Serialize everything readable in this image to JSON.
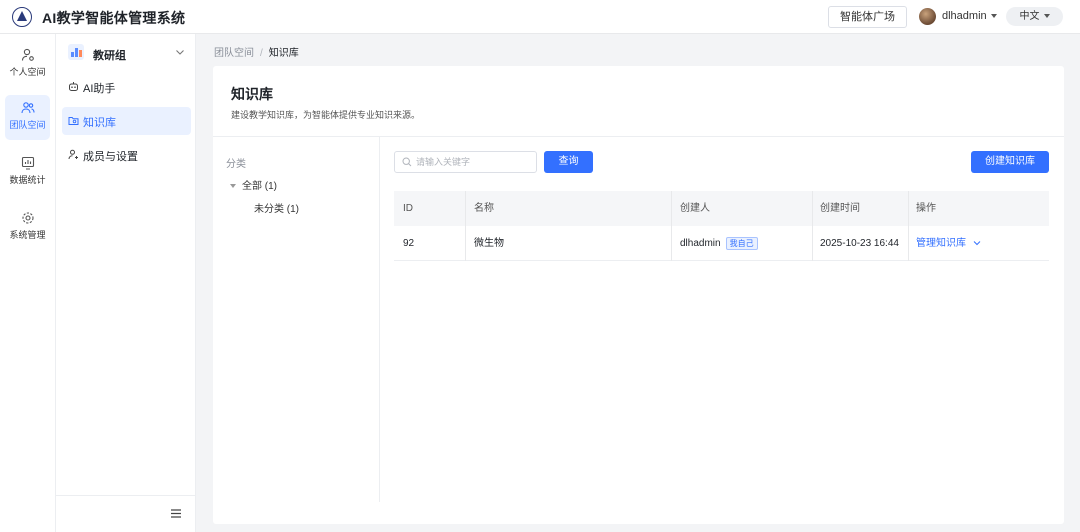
{
  "header": {
    "title": "AI教学智能体管理系统",
    "market_label": "智能体广场",
    "username": "dlhadmin",
    "language": "中文"
  },
  "rail": {
    "items": [
      {
        "label": "个人空间",
        "icon": "user-icon"
      },
      {
        "label": "团队空间",
        "icon": "team-icon"
      },
      {
        "label": "数据统计",
        "icon": "chart-icon"
      },
      {
        "label": "系统管理",
        "icon": "gear-icon"
      }
    ],
    "active_index": 1
  },
  "sidebar": {
    "group_name": "教研组",
    "items": [
      {
        "label": "AI助手",
        "icon": "bot-icon"
      },
      {
        "label": "知识库",
        "icon": "folder-icon"
      },
      {
        "label": "成员与设置",
        "icon": "member-settings-icon"
      }
    ],
    "active_index": 1
  },
  "breadcrumb": [
    "团队空间",
    "知识库"
  ],
  "page": {
    "title": "知识库",
    "description": "建设教学知识库，为智能体提供专业知识来源。"
  },
  "categories": {
    "heading": "分类",
    "all": "全部 (1)",
    "uncategorized": "未分类 (1)"
  },
  "search": {
    "placeholder": "请输入关键字",
    "value": "",
    "query_label": "查询"
  },
  "create_label": "创建知识库",
  "table": {
    "columns": [
      "ID",
      "名称",
      "创建人",
      "创建时间",
      "操作"
    ],
    "rows": [
      {
        "id": "92",
        "name": "微生物",
        "creator": "dlhadmin",
        "creator_tag": "我自己",
        "created_at": "2025-10-23 16:44",
        "action": "管理知识库"
      }
    ]
  },
  "colors": {
    "accent": "#3370ff",
    "active_bg": "#eaf1ff"
  }
}
